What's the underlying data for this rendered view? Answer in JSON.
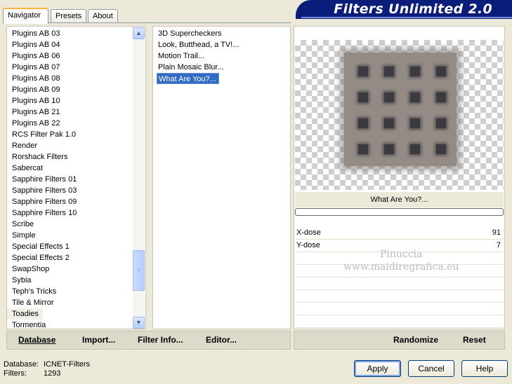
{
  "tabs": [
    "Navigator",
    "Presets",
    "About"
  ],
  "active_tab": "Navigator",
  "app_title": "Filters Unlimited 2.0",
  "categories": [
    "Plugins AB 03",
    "Plugins AB 04",
    "Plugins AB 06",
    "Plugins AB 07",
    "Plugins AB 08",
    "Plugins AB 09",
    "Plugins AB 10",
    "Plugins AB 21",
    "Plugins AB 22",
    "RCS Filter Pak 1.0",
    "Render",
    "Rorshack Filters",
    "Sabercat",
    "Sapphire Filters 01",
    "Sapphire Filters 03",
    "Sapphire Filters 09",
    "Sapphire Filters 10",
    "Scribe",
    "Simple",
    "Special Effects 1",
    "Special Effects 2",
    "SwapShop",
    "Sybia",
    "Teph's Tricks",
    "Tile & Mirror",
    "Toadies",
    "Tormentia"
  ],
  "selected_category": "Toadies",
  "filters": [
    "3D Supercheckers",
    "Look, Butthead, a TV!...",
    "Motion Trail...",
    "Plain Mosaic Blur...",
    "What Are You?..."
  ],
  "selected_filter": "What Are You?...",
  "preview": {
    "filter_name": "What Are You?...",
    "progress_percent": 0,
    "watermark_line1": "Pinuccia",
    "watermark_line2": "www.maidiregrafica.eu"
  },
  "params": [
    {
      "label": "X-dose",
      "value": "91"
    },
    {
      "label": "Y-dose",
      "value": "7"
    }
  ],
  "left_bar": {
    "database": "Database",
    "import": "Import...",
    "filter_info": "Filter Info...",
    "editor": "Editor..."
  },
  "right_bar": {
    "randomize": "Randomize",
    "reset": "Reset"
  },
  "footer": {
    "database_label": "Database:",
    "database_value": "ICNET-Filters",
    "filters_label": "Filters:",
    "filters_value": "1293"
  },
  "buttons": {
    "apply": "Apply",
    "cancel": "Cancel",
    "help": "Help"
  },
  "colors": {
    "banner": "#0b1d7a",
    "selection": "#316ac5",
    "window_bg": "#ece9d8"
  }
}
